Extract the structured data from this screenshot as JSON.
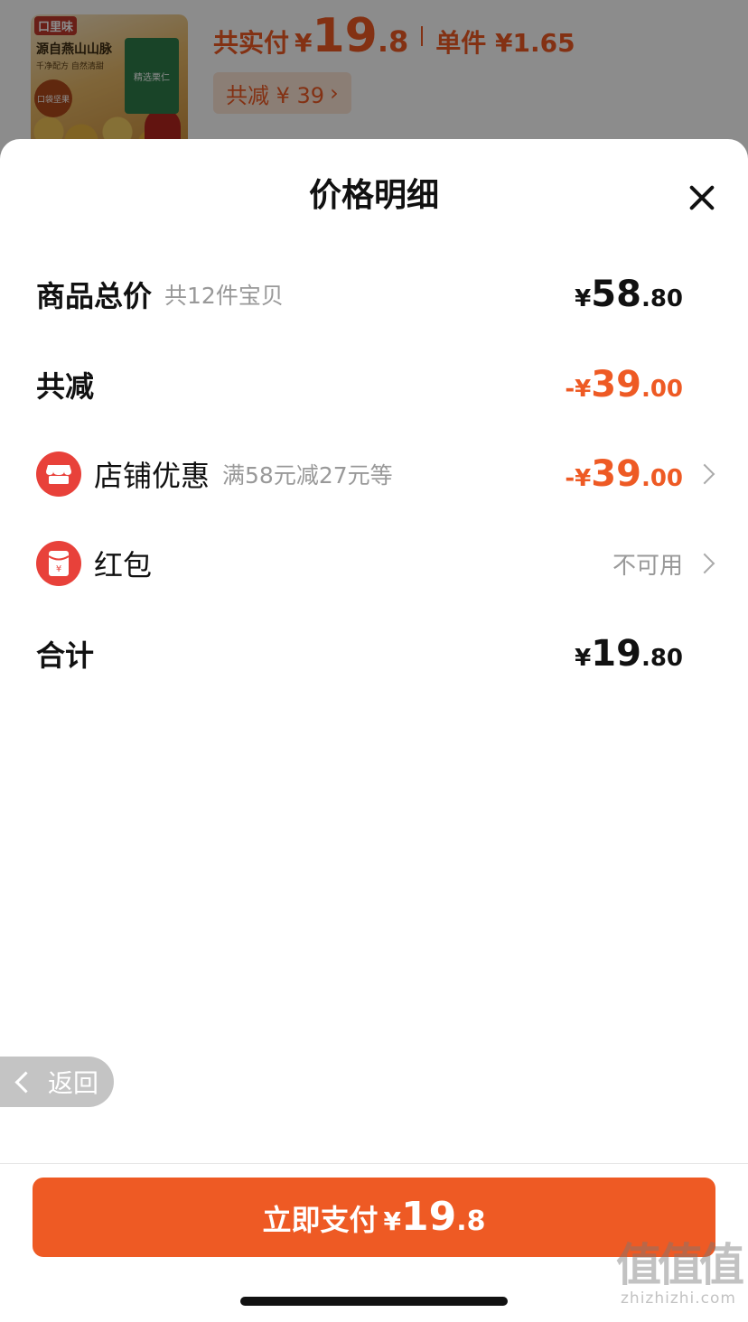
{
  "background": {
    "product_image": {
      "brand": "口里味",
      "headline": "源自燕山山脉",
      "subline": "千净配方 自然清甜",
      "tag": "口袋坚果",
      "pack_label": "精选栗仁"
    },
    "paid_label": "共实付",
    "paid_symbol": "¥",
    "paid_int": "19",
    "paid_dec": ".8",
    "unit_label": "单件 ¥1.65",
    "discount_pill": "共减 ¥ 39",
    "discount_pill_arrow": "›"
  },
  "sheet": {
    "title": "价格明细",
    "rows": {
      "total": {
        "label": "商品总价",
        "sub": "共12件宝贝",
        "sym": "¥",
        "int": "58",
        "dec": ".80"
      },
      "reduced": {
        "label": "共减",
        "sym": "-¥",
        "int": "39",
        "dec": ".00"
      },
      "shop_discount": {
        "label": "店铺优惠",
        "sub": "满58元减27元等",
        "sym": "-¥",
        "int": "39",
        "dec": ".00",
        "icon": "shop-icon"
      },
      "red_packet": {
        "label": "红包",
        "status": "不可用",
        "icon": "red-packet-icon"
      },
      "sum": {
        "label": "合计",
        "sym": "¥",
        "int": "19",
        "dec": ".80"
      }
    },
    "back_label": "返回",
    "pay_button": {
      "label": "立即支付",
      "sym": "¥",
      "int": "19",
      "dec": ".8"
    }
  },
  "watermark": {
    "big": "值值值",
    "small": "zhizhizhi.com"
  },
  "colors": {
    "accent": "#ee5a24",
    "icon_red": "#e8413a"
  }
}
